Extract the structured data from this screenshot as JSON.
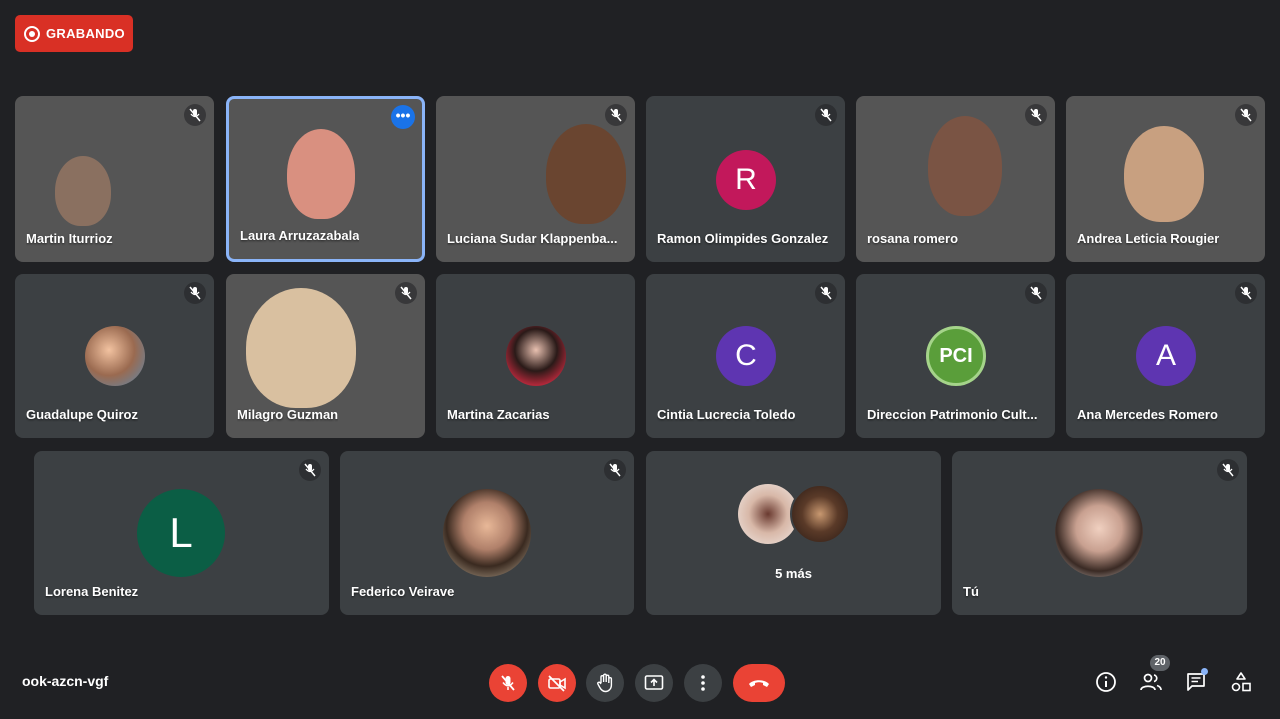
{
  "recording": {
    "label": "GRABANDO"
  },
  "meeting": {
    "code": "ook-azcn-vgf"
  },
  "participants": [
    {
      "name": "Martin Iturrioz"
    },
    {
      "name": "Laura Arruzazabala"
    },
    {
      "name": "Luciana Sudar Klappenba..."
    },
    {
      "name": "Ramon Olimpides Gonzalez",
      "initial": "R",
      "color": "#c2185b"
    },
    {
      "name": "rosana romero"
    },
    {
      "name": "Andrea Leticia Rougier"
    },
    {
      "name": "Guadalupe Quiroz"
    },
    {
      "name": "Milagro Guzman"
    },
    {
      "name": "Martina Zacarias"
    },
    {
      "name": "Cintia Lucrecia Toledo",
      "initial": "C",
      "color": "#5e35b1"
    },
    {
      "name": "Direccion Patrimonio Cult...",
      "logo": "PCI"
    },
    {
      "name": "Ana Mercedes Romero",
      "initial": "A",
      "color": "#5e35b1"
    },
    {
      "name": "Lorena Benitez",
      "initial": "L",
      "color": "#0b5e45"
    },
    {
      "name": "Federico Veirave"
    },
    {
      "more": "5 más"
    },
    {
      "name": "Tú"
    }
  ],
  "controls": {
    "participant_count": "20"
  },
  "colors": {
    "background": "#202124",
    "tile": "#3c4043",
    "recording": "#d93025",
    "hangup": "#ea4335",
    "active_speaker": "#8ab4f8"
  }
}
